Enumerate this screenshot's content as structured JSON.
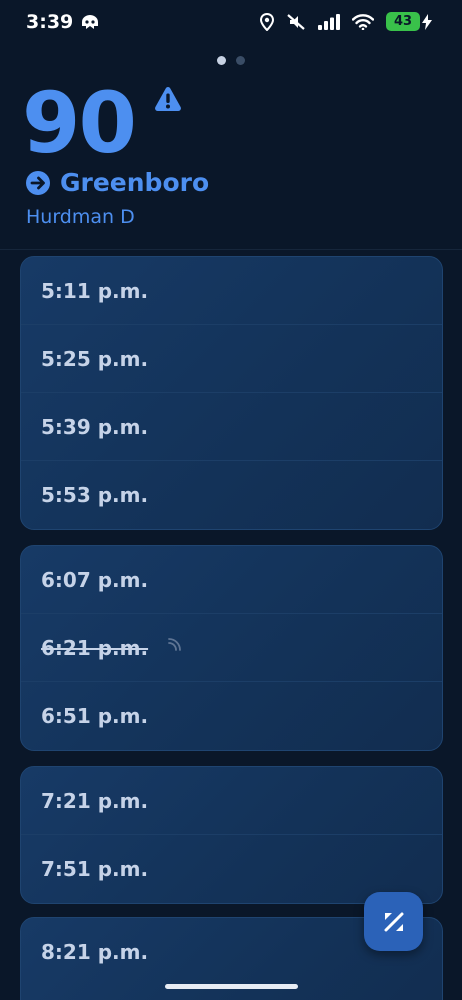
{
  "status_bar": {
    "time": "3:39",
    "battery": "43"
  },
  "page_dots": {
    "count": 2,
    "active_index": 0
  },
  "header": {
    "route_number": "90",
    "destination": "Greenboro",
    "stop_name": "Hurdman D"
  },
  "schedule": {
    "groups": [
      {
        "times": [
          {
            "label": "5:11 p.m."
          },
          {
            "label": "5:25 p.m."
          },
          {
            "label": "5:39 p.m."
          },
          {
            "label": "5:53 p.m."
          }
        ]
      },
      {
        "times": [
          {
            "label": "6:07 p.m."
          },
          {
            "label": "6:21 p.m.",
            "status": "cancelled"
          },
          {
            "label": "6:51 p.m."
          }
        ]
      },
      {
        "times": [
          {
            "label": "7:21 p.m."
          },
          {
            "label": "7:51 p.m."
          }
        ]
      },
      {
        "times": [
          {
            "label": "8:21 p.m."
          }
        ]
      }
    ]
  },
  "colors": {
    "accent": "#4d8ff0",
    "background": "#0a1729",
    "card": "#173a66",
    "battery": "#39c14a"
  },
  "icons": {
    "alert": "alert-triangle-icon",
    "direction": "arrow-right-circle-icon",
    "fab": "percent-transit-icon"
  }
}
